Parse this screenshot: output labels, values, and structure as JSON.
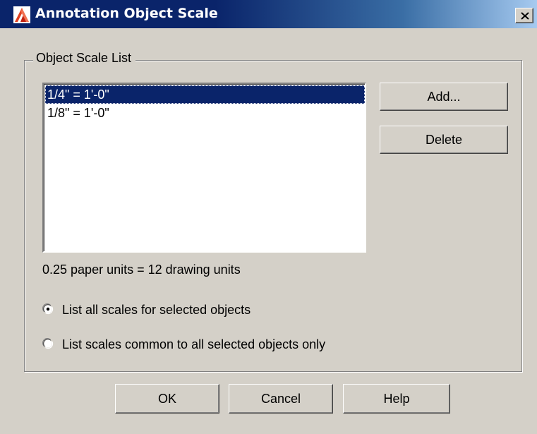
{
  "window": {
    "title": "Annotation Object Scale",
    "close_symbol": "✕"
  },
  "group": {
    "legend": "Object Scale List"
  },
  "scale_list": {
    "items": [
      {
        "label": "1/4\" = 1'-0\"",
        "selected": true
      },
      {
        "label": "1/8\" = 1'-0\"",
        "selected": false
      }
    ]
  },
  "buttons": {
    "add": "Add...",
    "delete": "Delete",
    "ok": "OK",
    "cancel": "Cancel",
    "help": "Help"
  },
  "info": {
    "units_text": "0.25 paper units = 12 drawing units"
  },
  "options": {
    "list_all": {
      "label": "List all scales for selected objects",
      "checked": true
    },
    "list_common": {
      "label": "List scales common to all selected objects only",
      "checked": false
    }
  },
  "colors": {
    "titlebar": "#0a246a",
    "selection": "#0a246a",
    "dialog_face": "#d4d0c8",
    "app_icon": "#e04020"
  },
  "icons": {
    "app": "autocad-icon",
    "close": "close-icon"
  }
}
